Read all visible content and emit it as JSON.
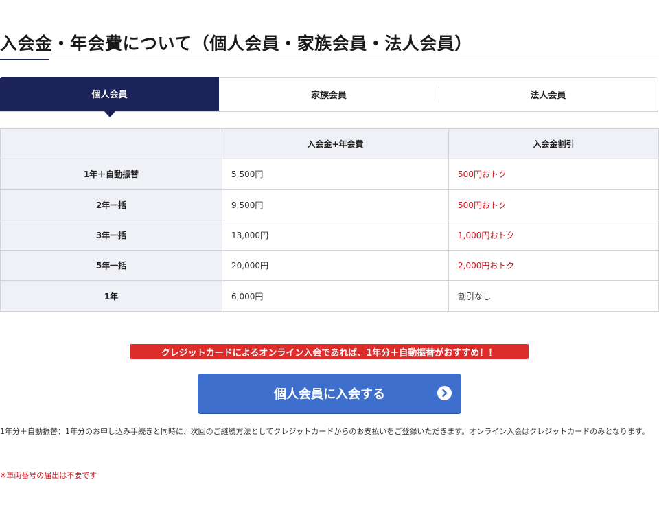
{
  "page_title": "入会金・年会費について（個人会員・家族会員・法人会員）",
  "tabs": [
    {
      "label": "個人会員",
      "active": true
    },
    {
      "label": "家族会員",
      "active": false
    },
    {
      "label": "法人会員",
      "active": false
    }
  ],
  "table": {
    "headers": [
      "",
      "入会金+年会費",
      "入会金割引"
    ],
    "rows": [
      {
        "plan": "1年＋自動振替",
        "price": "5,500円",
        "discount": "500円おトク"
      },
      {
        "plan": "2年一括",
        "price": "9,500円",
        "discount": "500円おトク"
      },
      {
        "plan": "3年一括",
        "price": "13,000円",
        "discount": "1,000円おトク"
      },
      {
        "plan": "5年一括",
        "price": "20,000円",
        "discount": "2,000円おトク"
      },
      {
        "plan": "1年",
        "price": "6,000円",
        "discount": "割引なし"
      }
    ]
  },
  "recommend_banner": "クレジットカードによるオンライン入会であれば、1年分＋自動振替がおすすめ！！",
  "join_button_label": "個人会員に入会する",
  "note": "1年分＋自動振替：1年分のお申し込み手続きと同時に、次回のご継続方法としてクレジットカードからのお支払いをご登録いただきます。オンライン入会はクレジットカードのみとなります。",
  "warning": "※車両番号の届出は不要です",
  "colors": {
    "navy": "#1b2358",
    "button_blue": "#3f6fcc",
    "red": "#dc2d2b",
    "discount_red": "#c8161d",
    "header_bg": "#eff1f6"
  }
}
